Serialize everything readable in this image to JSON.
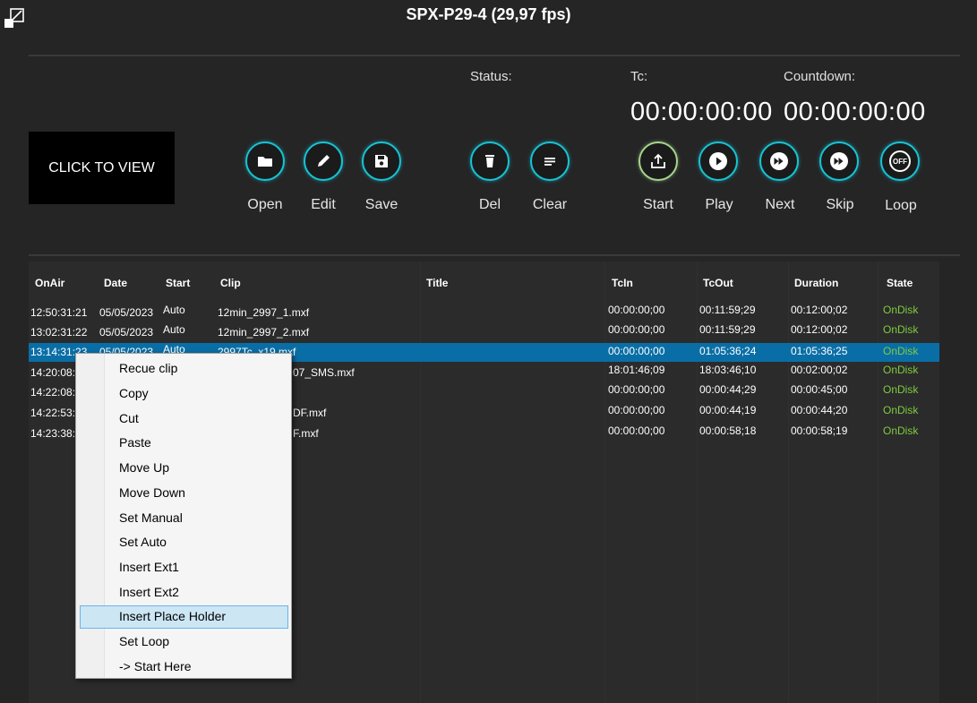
{
  "window": {
    "title": "SPX-P29-4 (29,97 fps)"
  },
  "preview": {
    "label": "CLICK TO VIEW"
  },
  "toolbar": {
    "open": "Open",
    "edit": "Edit",
    "save": "Save",
    "del": "Del",
    "clear": "Clear",
    "start": "Start",
    "play": "Play",
    "next": "Next",
    "skip": "Skip",
    "loop": "Loop",
    "loop_icon_text": "OFF"
  },
  "status": {
    "status_label": "Status:",
    "tc_label": "Tc:",
    "countdown_label": "Countdown:",
    "tc_value": "00:00:00:00",
    "countdown_value": "00:00:00:00"
  },
  "table": {
    "headers": {
      "onair": "OnAir",
      "date": "Date",
      "start": "Start",
      "clip": "Clip",
      "title": "Title",
      "tcin": "TcIn",
      "tcout": "TcOut",
      "duration": "Duration",
      "state": "State"
    },
    "rows": [
      {
        "onair": "12:50:31:21",
        "date": "05/05/2023",
        "start": "Auto",
        "clip": "12min_2997_1.mxf",
        "title": "",
        "tcin": "00:00:00;00",
        "tcout": "00:11:59;29",
        "duration": "00:12:00;02",
        "state": "OnDisk"
      },
      {
        "onair": "13:02:31:22",
        "date": "05/05/2023",
        "start": "Auto",
        "clip": "12min_2997_2.mxf",
        "title": "",
        "tcin": "00:00:00;00",
        "tcout": "00:11:59;29",
        "duration": "00:12:00;02",
        "state": "OnDisk"
      },
      {
        "onair": "13:14:31:23",
        "date": "05/05/2023",
        "start": "Auto",
        "clip": "2997Tc_x19.mxf",
        "title": "",
        "tcin": "00:00:00;00",
        "tcout": "01:05:36;24",
        "duration": "01:05:36;25",
        "state": "OnDisk"
      },
      {
        "onair": "14:20:08:",
        "date": "",
        "start": "",
        "clip": "07_SMS.mxf",
        "title": "",
        "tcin": "18:01:46;09",
        "tcout": "18:03:46;10",
        "duration": "00:02:00;02",
        "state": "OnDisk"
      },
      {
        "onair": "14:22:08:",
        "date": "",
        "start": "",
        "clip": "",
        "title": "",
        "tcin": "00:00:00;00",
        "tcout": "00:00:44;29",
        "duration": "00:00:45;00",
        "state": "OnDisk"
      },
      {
        "onair": "14:22:53:",
        "date": "",
        "start": "",
        "clip": "DF.mxf",
        "title": "",
        "tcin": "00:00:00;00",
        "tcout": "00:00:44;19",
        "duration": "00:00:44;20",
        "state": "OnDisk"
      },
      {
        "onair": "14:23:38:",
        "date": "",
        "start": "",
        "clip": "F.mxf",
        "title": "",
        "tcin": "00:00:00;00",
        "tcout": "00:00:58;18",
        "duration": "00:00:58;19",
        "state": "OnDisk"
      }
    ]
  },
  "context_menu": {
    "items": [
      "Recue clip",
      "Copy",
      "Cut",
      "Paste",
      "Move Up",
      "Move Down",
      "Set Manual",
      "Set Auto",
      "Insert Ext1",
      "Insert Ext2",
      "Insert Place Holder",
      "Set Loop",
      "-> Start Here"
    ],
    "highlighted": "Insert Place Holder"
  },
  "colors": {
    "accent": "#17c3d3",
    "start_ring": "#a6d48c",
    "selected_row": "#0a6ea6",
    "state_ok": "#7ecb3f"
  }
}
